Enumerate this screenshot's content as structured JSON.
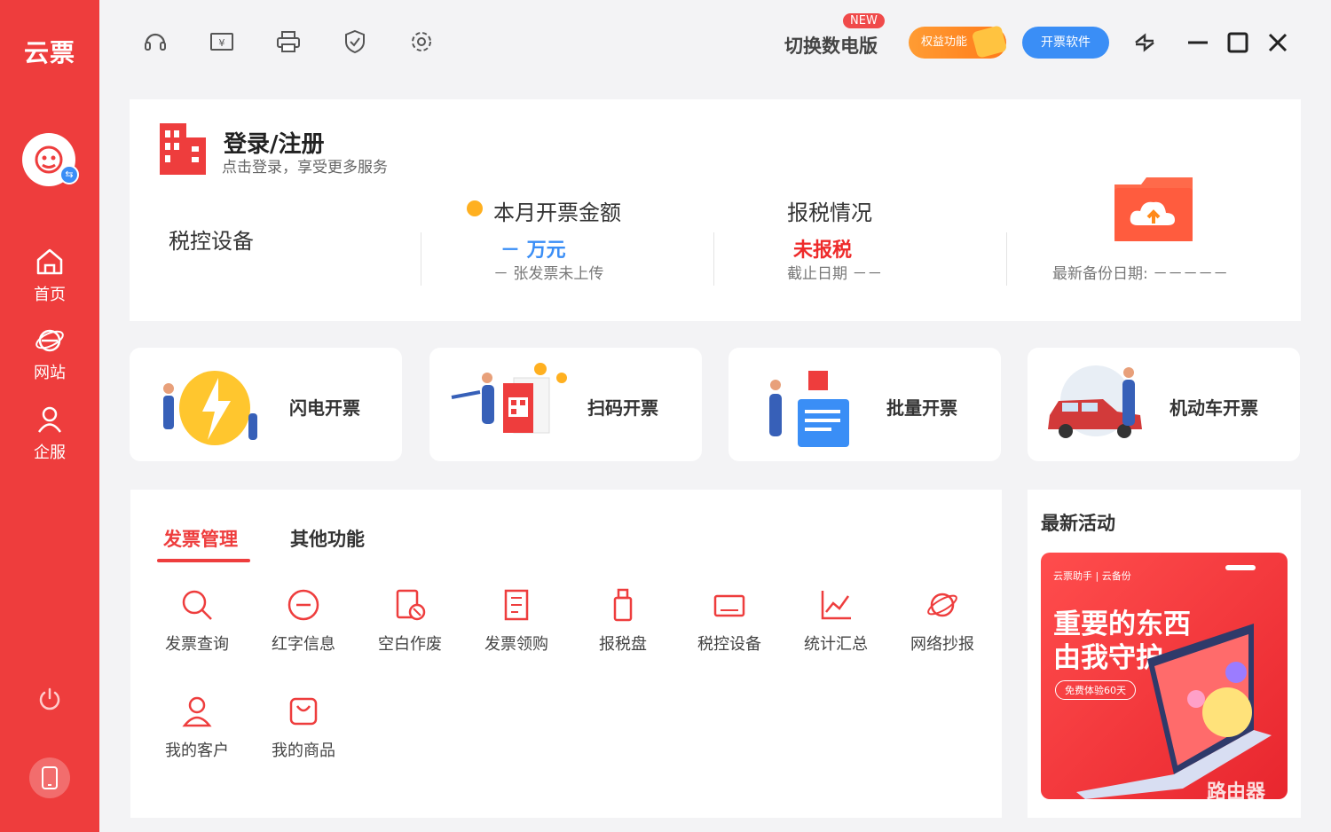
{
  "app": {
    "logo_text": "云票"
  },
  "sidebar": {
    "items": [
      {
        "label": "首页",
        "icon": "home-icon"
      },
      {
        "label": "网站",
        "icon": "browser-icon"
      },
      {
        "label": "企服",
        "icon": "user-icon"
      }
    ]
  },
  "topbar": {
    "switch_label": "切换数电版",
    "new_badge": "NEW",
    "rights_label": "权益功能",
    "software_label": "开票软件"
  },
  "info": {
    "login_title": "登录/注册",
    "login_sub": "点击登录，享受更多服务",
    "device_label": "税控设备",
    "monthly_label": "本月开票金额",
    "monthly_value": "－ 万元",
    "monthly_sub": "－ 张发票未上传",
    "tax_label": "报税情况",
    "tax_status": "未报税",
    "tax_deadline": "截止日期 －－",
    "backup_label": "最新备份日期: －－－－－"
  },
  "quick_cards": [
    {
      "label": "闪电开票"
    },
    {
      "label": "扫码开票"
    },
    {
      "label": "批量开票"
    },
    {
      "label": "机动车开票"
    }
  ],
  "tabs": {
    "active": "发票管理",
    "other": "其他功能"
  },
  "functions": [
    {
      "label": "发票查询",
      "icon": "search-icon"
    },
    {
      "label": "红字信息",
      "icon": "minus-circle-icon"
    },
    {
      "label": "空白作废",
      "icon": "void-doc-icon"
    },
    {
      "label": "发票领购",
      "icon": "receipt-icon"
    },
    {
      "label": "报税盘",
      "icon": "usb-drive-icon"
    },
    {
      "label": "税控设备",
      "icon": "device-icon"
    },
    {
      "label": "统计汇总",
      "icon": "chart-line-icon"
    },
    {
      "label": "网络抄报",
      "icon": "planet-icon"
    },
    {
      "label": "我的客户",
      "icon": "customer-icon"
    },
    {
      "label": "我的商品",
      "icon": "bag-icon"
    }
  ],
  "activity": {
    "title": "最新活动",
    "banner_top": "云票助手 | 云备份",
    "banner_line1": "重要的东西",
    "banner_line2": "由我守护",
    "banner_pill": "免费体验60天"
  },
  "watermark": "路由器",
  "colors": {
    "brand_red": "#ee3d3d",
    "blue": "#3a8ef6",
    "orange": "#ff8c26"
  }
}
